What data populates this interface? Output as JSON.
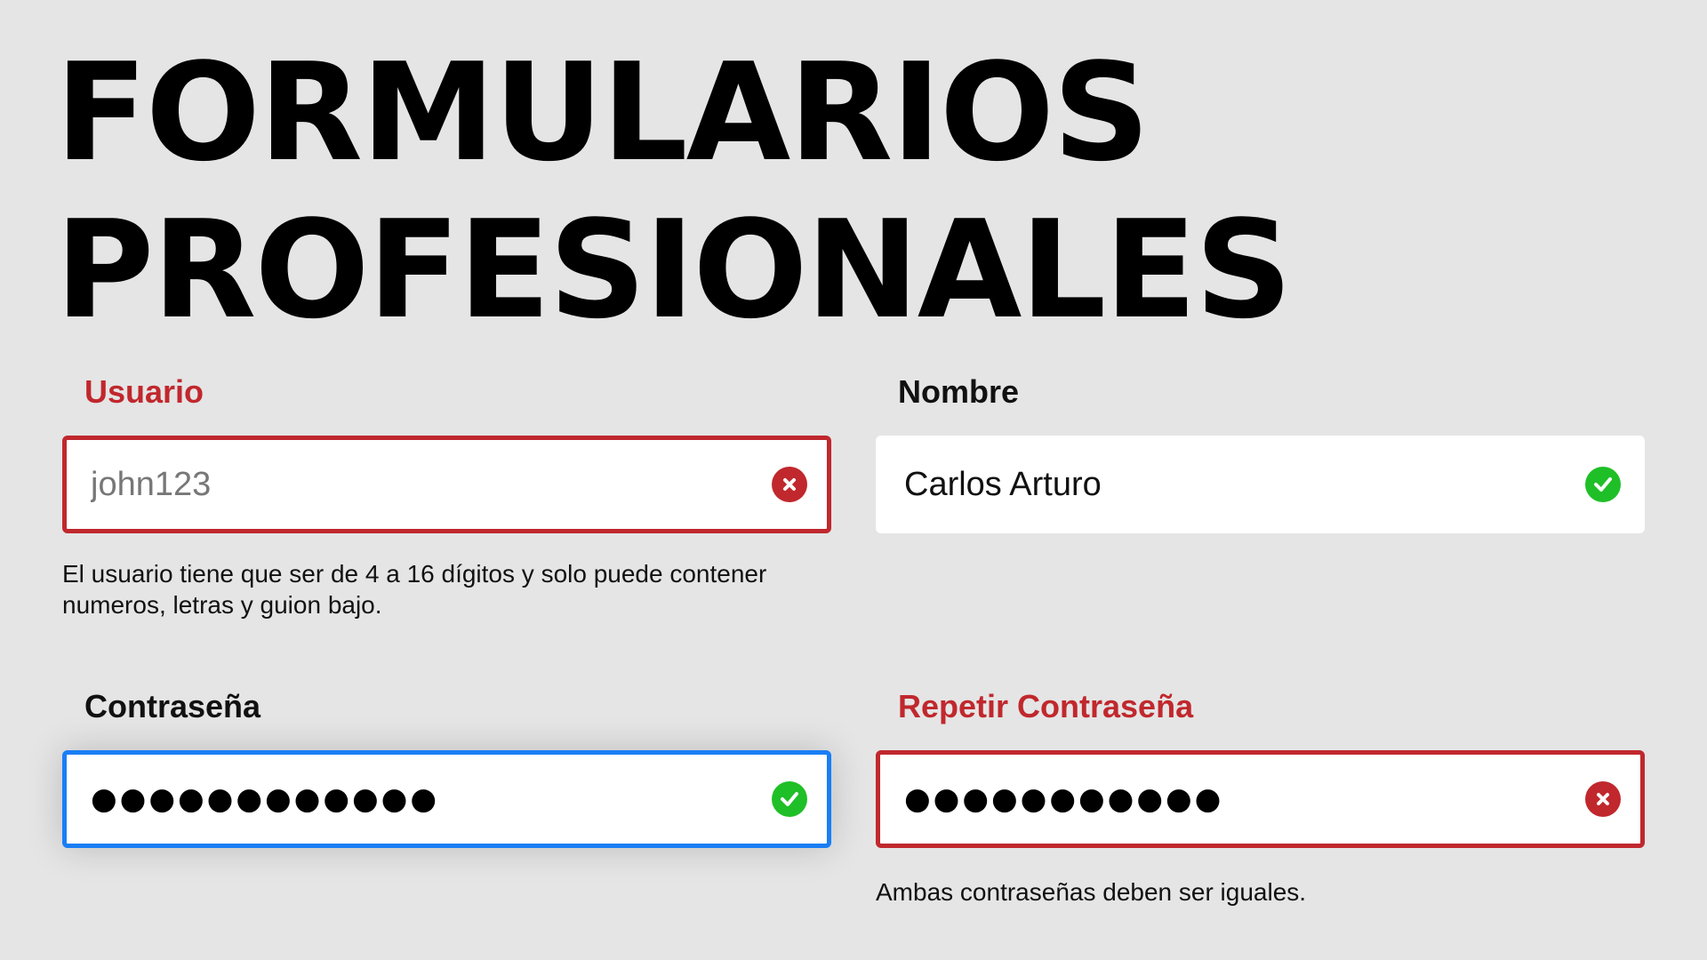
{
  "title": {
    "line1": "FORMULARIOS",
    "line2": "PROFESIONALES"
  },
  "fields": {
    "usuario": {
      "label": "Usuario",
      "placeholder": "john123",
      "value": "",
      "state": "error",
      "status_icon": "error-x-icon",
      "help": "El usuario tiene que ser de 4 a 16 dígitos y solo puede contener numeros, letras y guion bajo."
    },
    "nombre": {
      "label": "Nombre",
      "value": "Carlos Arturo",
      "state": "valid",
      "status_icon": "check-icon"
    },
    "password": {
      "label": "Contraseña",
      "masked": "●●●●●●●●●●●●",
      "state": "valid-focused",
      "status_icon": "check-icon"
    },
    "password2": {
      "label": "Repetir Contraseña",
      "masked": "●●●●●●●●●●●",
      "state": "error",
      "status_icon": "error-x-icon",
      "help": "Ambas contraseñas deben ser iguales."
    }
  },
  "colors": {
    "background": "#e5e5e5",
    "error": "#c0282d",
    "valid": "#1fbf27",
    "focus": "#1a7ef5"
  }
}
